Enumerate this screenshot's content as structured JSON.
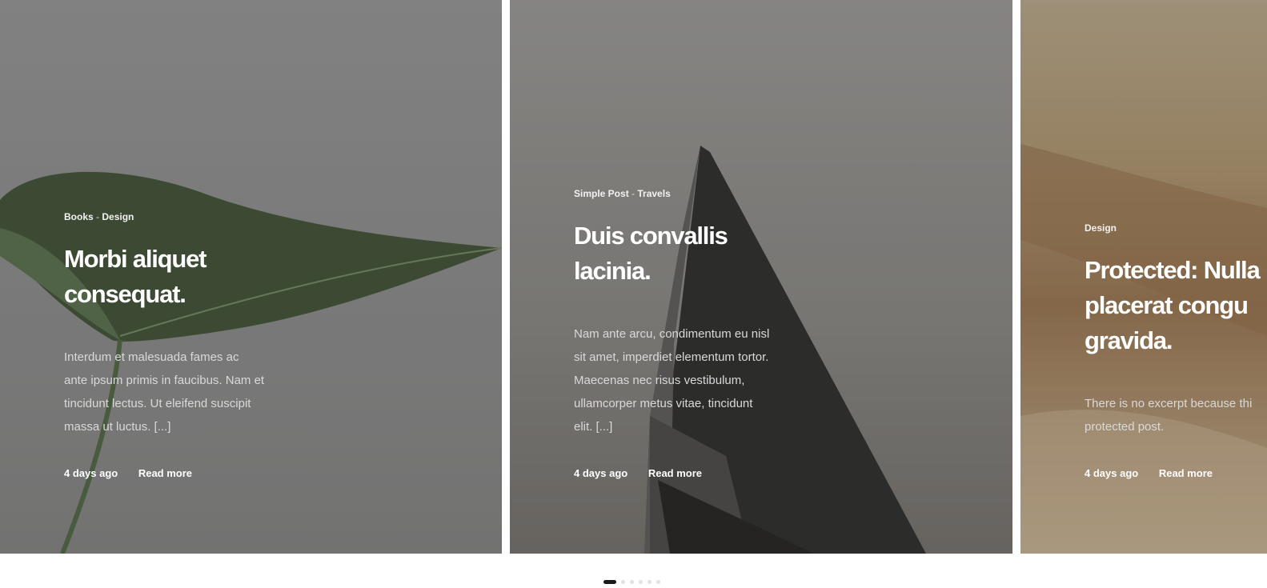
{
  "slides": [
    {
      "categories": [
        "Books",
        "Design"
      ],
      "separator": "-",
      "title_lines": [
        "Morbi aliquet",
        "consequat."
      ],
      "excerpt_lines": [
        "Interdum et malesuada fames ac",
        "ante ipsum primis in faucibus. Nam et",
        "tincidunt lectus. Ut eleifend suscipit",
        "massa ut luctus. [...]"
      ],
      "date": "4 days ago",
      "read_more": "Read more"
    },
    {
      "categories": [
        "Simple Post",
        "Travels"
      ],
      "separator": "-",
      "title_lines": [
        "Duis convallis",
        "lacinia."
      ],
      "excerpt_lines": [
        "Nam ante arcu, condimentum eu nisl",
        "sit amet, imperdiet elementum tortor.",
        "Maecenas nec risus vestibulum,",
        "ullamcorper metus vitae, tincidunt",
        "elit. [...]"
      ],
      "date": "4 days ago",
      "read_more": "Read more"
    },
    {
      "categories": [
        "Design"
      ],
      "title_lines": [
        "Protected: Nulla",
        "placerat congu",
        "gravida."
      ],
      "excerpt_lines": [
        "There is no excerpt because thi",
        "protected post."
      ],
      "date": "4 days ago",
      "read_more": "Read more"
    }
  ],
  "pagination": {
    "total": 6,
    "active": 1
  },
  "colors": {
    "active_dot": "#1a1a1a",
    "inactive_dot": "#e2e2e2"
  },
  "icons": {
    "slide_1_image": "leaf-image",
    "slide_2_image": "building-image",
    "slide_3_image": "sand-dune-image"
  }
}
